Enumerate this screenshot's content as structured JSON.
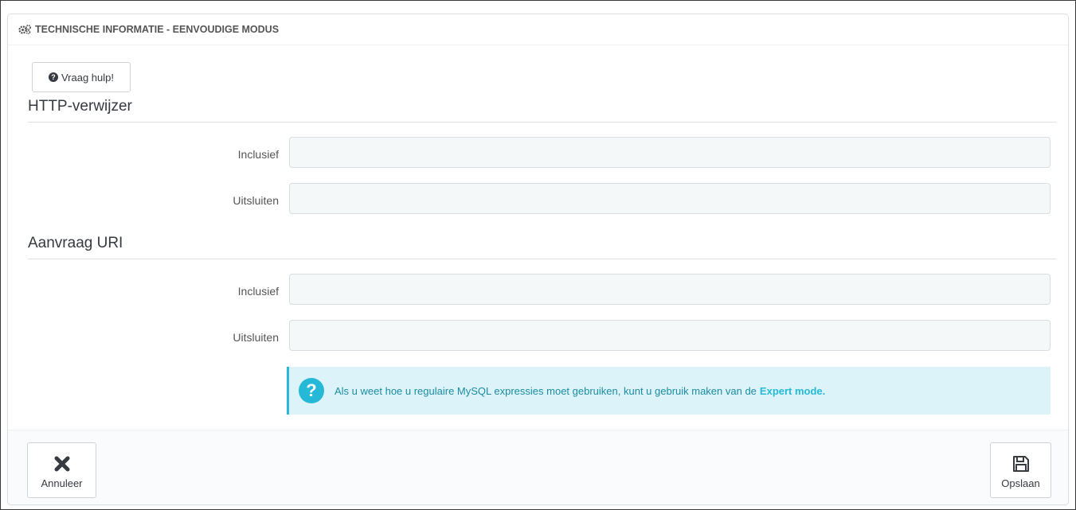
{
  "panel": {
    "heading": "TECHNISCHE INFORMATIE - EENVOUDIGE MODUS",
    "heading_icon": "cogs-icon"
  },
  "help_button": {
    "label": "Vraag hulp!",
    "icon": "question-circle-icon"
  },
  "sections": [
    {
      "title": "HTTP-verwijzer",
      "fields": [
        {
          "label": "Inclusief",
          "value": ""
        },
        {
          "label": "Uitsluiten",
          "value": ""
        }
      ]
    },
    {
      "title": "Aanvraag URI",
      "fields": [
        {
          "label": "Inclusief",
          "value": ""
        },
        {
          "label": "Uitsluiten",
          "value": ""
        }
      ]
    }
  ],
  "alert": {
    "text": "Als u weet hoe u regulaire MySQL expressies moet gebruiken, kunt u gebruik maken van de",
    "link": "Expert mode.",
    "icon": "question-icon"
  },
  "footer": {
    "cancel_label": "Annuleer",
    "cancel_icon": "close-icon",
    "save_label": "Opslaan",
    "save_icon": "save-icon"
  },
  "colors": {
    "accent": "#25b9d7",
    "alert_bg": "#dcf4f9",
    "input_bg": "#f5f8f9",
    "text": "#363a41"
  }
}
